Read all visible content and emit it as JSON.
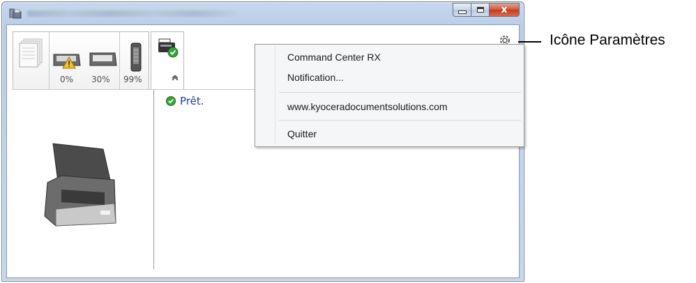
{
  "window": {
    "title_blurred": true,
    "close_glyph": "x"
  },
  "tabs": {
    "percentages": [
      "0%",
      "30%",
      "99%"
    ],
    "collapse_glyph": "▲"
  },
  "status": {
    "text": "Prêt.",
    "color": "#1f3f8f"
  },
  "menu": {
    "items": [
      {
        "label": "Command Center RX"
      },
      {
        "label": "Notification..."
      },
      {
        "label": "www.kyoceradocumentsolutions.com"
      },
      {
        "label": "Quitter"
      }
    ]
  },
  "settings_icon": "gear-icon",
  "callout": {
    "label": "Icône Paramètres"
  }
}
